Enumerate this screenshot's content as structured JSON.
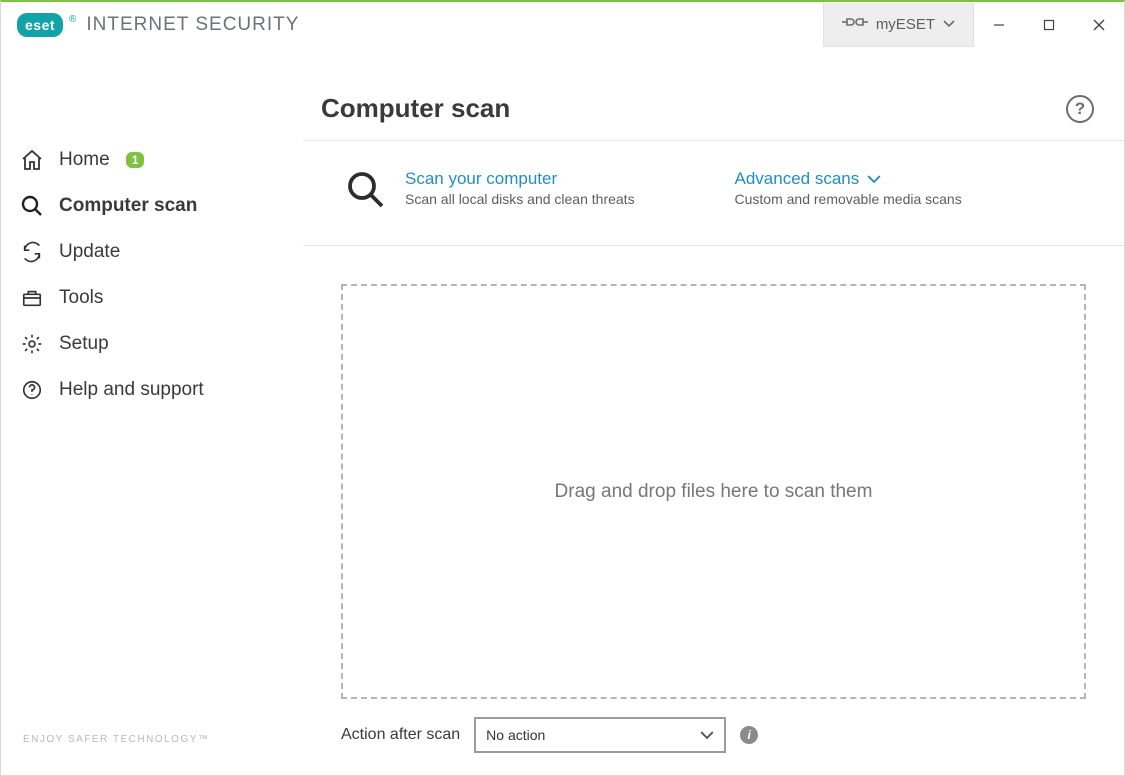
{
  "brand": {
    "logo_text": "eset",
    "product": "INTERNET SECURITY",
    "footer": "ENJOY SAFER TECHNOLOGY™"
  },
  "titlebar": {
    "myeset_label": "myESET"
  },
  "sidebar": {
    "items": [
      {
        "label": "Home",
        "badge": "1"
      },
      {
        "label": "Computer scan"
      },
      {
        "label": "Update"
      },
      {
        "label": "Tools"
      },
      {
        "label": "Setup"
      },
      {
        "label": "Help and support"
      }
    ]
  },
  "page": {
    "title": "Computer scan",
    "scan_option": {
      "title": "Scan your computer",
      "subtitle": "Scan all local disks and clean threats"
    },
    "advanced_option": {
      "title": "Advanced scans",
      "subtitle": "Custom and removable media scans"
    },
    "dropzone_text": "Drag and drop files here to scan them",
    "action_label": "Action after scan",
    "action_value": "No action"
  }
}
